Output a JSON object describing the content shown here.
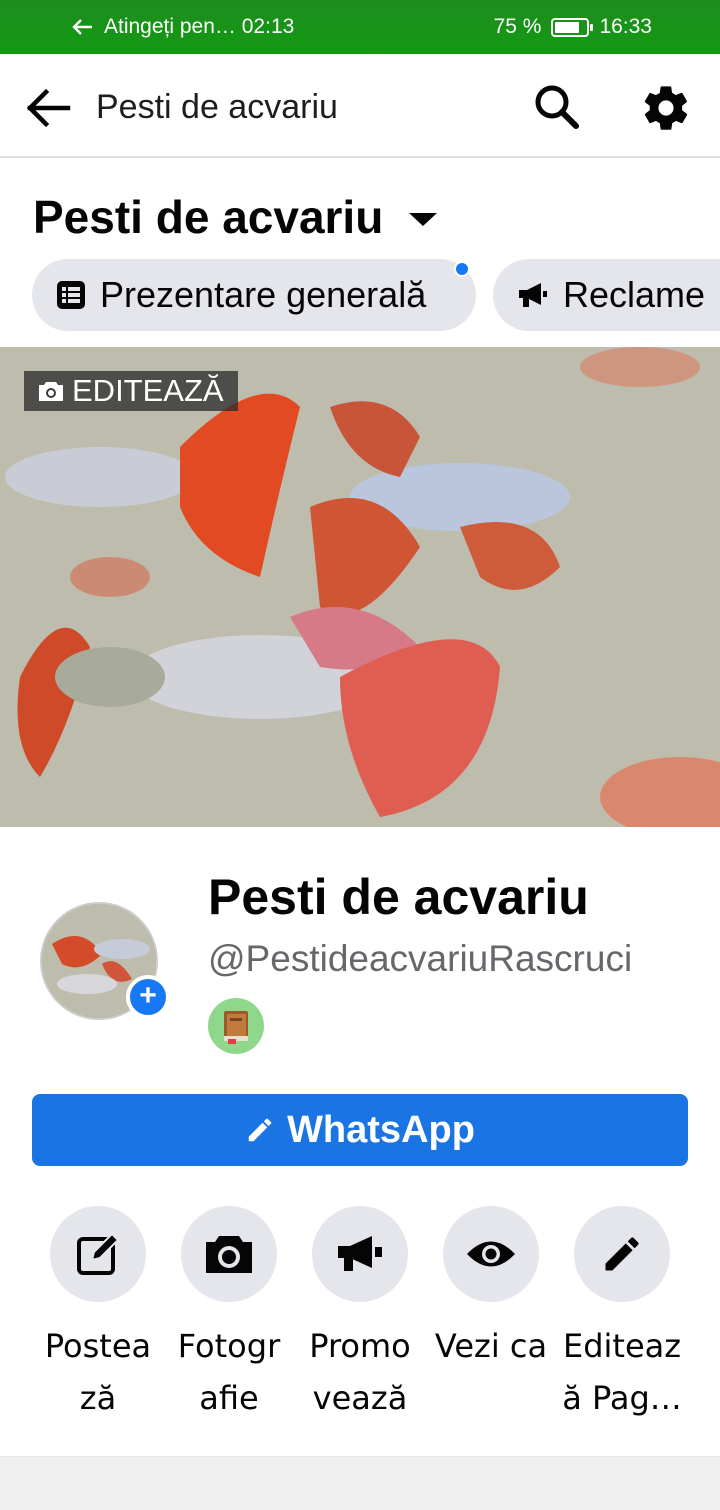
{
  "status_bar": {
    "notification": "Atingeți pen… 02:13",
    "battery_percent": "75 %",
    "battery_level": 0.75,
    "time": "16:33"
  },
  "app_bar": {
    "title": "Pesti de acvariu"
  },
  "page_heading": {
    "title": "Pesti de acvariu"
  },
  "chips": [
    {
      "label": "Prezentare generală",
      "icon": "list-icon",
      "has_dot": true
    },
    {
      "label": "Reclame",
      "icon": "megaphone-icon"
    }
  ],
  "cover": {
    "edit_label": "EDITEAZĂ"
  },
  "profile": {
    "name": "Pesti de acvariu",
    "handle": "@PestideacvariuRascruci",
    "avatar_add": "+"
  },
  "whatsapp": {
    "label": "WhatsApp"
  },
  "actions": [
    {
      "line1": "Postea",
      "line2": "ză",
      "icon": "compose-icon"
    },
    {
      "line1": "Fotogr",
      "line2": "afie",
      "icon": "camera-icon"
    },
    {
      "line1": "Promo",
      "line2": "vează",
      "icon": "megaphone-icon"
    },
    {
      "line1": "Vezi ca",
      "line2": "",
      "icon": "eye-icon"
    },
    {
      "line1": "Editeaz",
      "line2": "ă Pag…",
      "icon": "pencil-icon"
    }
  ],
  "colors": {
    "status_bar": "#1e8c1e",
    "accent": "#1b74e4",
    "chip_bg": "#e4e6eb"
  }
}
